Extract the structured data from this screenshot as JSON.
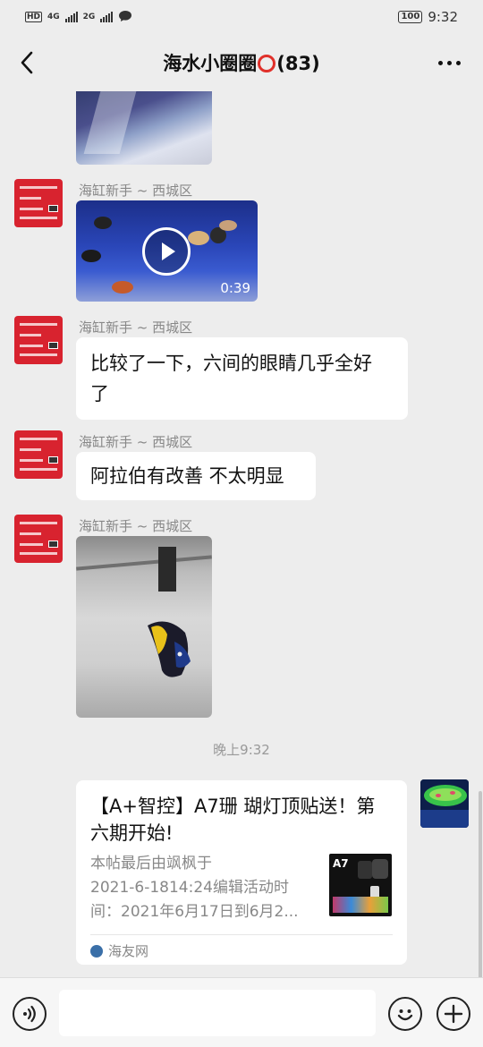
{
  "status_bar": {
    "left_label": "HD",
    "net1": "4G",
    "net2": "2G",
    "battery": "100",
    "time": "9:32"
  },
  "header": {
    "title_before": "海水小圈圈",
    "title_after": "(83)"
  },
  "messages": [
    {
      "sender": "海缸新手 ~ 西城区",
      "type": "video",
      "duration": "0:39"
    },
    {
      "sender": "海缸新手 ~ 西城区",
      "type": "text",
      "line1": "比较了一下，六间的眼睛几乎全好",
      "line2": "了"
    },
    {
      "sender": "海缸新手 ~ 西城区",
      "type": "text",
      "line1": "阿拉伯有改善 不太明显"
    },
    {
      "sender": "海缸新手 ~ 西城区",
      "type": "image"
    }
  ],
  "time_separator": "晚上9:32",
  "card": {
    "title_line1": "【A+智控】A7珊 瑚灯顶贴送！第",
    "title_line2": "六期开始!",
    "desc_line1": "本帖最后由飒枫于",
    "desc_line2": "2021-6-1814:24编辑活动时",
    "desc_line3": "间：2021年6月17日到6月2...",
    "thumb_label": "A7",
    "source": "海友网"
  },
  "colors": {
    "background": "#ededed",
    "avatar_red": "#d8232f",
    "ring_red": "#e0302a"
  }
}
